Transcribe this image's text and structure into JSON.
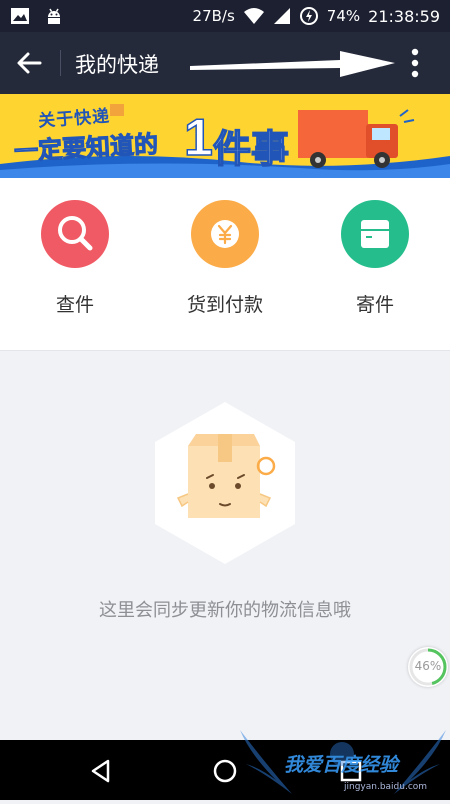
{
  "status_bar": {
    "speed": "27B/s",
    "battery": "74%",
    "time": "21:38:59"
  },
  "app_bar": {
    "title": "我的快递"
  },
  "banner": {
    "line1": "关于快递",
    "line2": "一定要知道的",
    "line3_num": "1",
    "line3_text": "件事"
  },
  "actions": [
    {
      "label": "查件",
      "icon": "search-icon",
      "color": "#f05a64"
    },
    {
      "label": "货到付款",
      "icon": "yuan-icon",
      "color": "#fbab47"
    },
    {
      "label": "寄件",
      "icon": "box-icon",
      "color": "#24bd8b"
    }
  ],
  "empty_state": {
    "message": "这里会同步更新你的物流信息哦"
  },
  "progress": {
    "label": "46%",
    "value": 0.46
  },
  "watermark": {
    "text": "我爱百度经验",
    "url": "jingyan.baidu.com"
  },
  "colors": {
    "status_bar": "#1c2030",
    "app_bar": "#252a3a",
    "banner_bg": "#fdd430",
    "page_bg": "#f1f2f6"
  }
}
